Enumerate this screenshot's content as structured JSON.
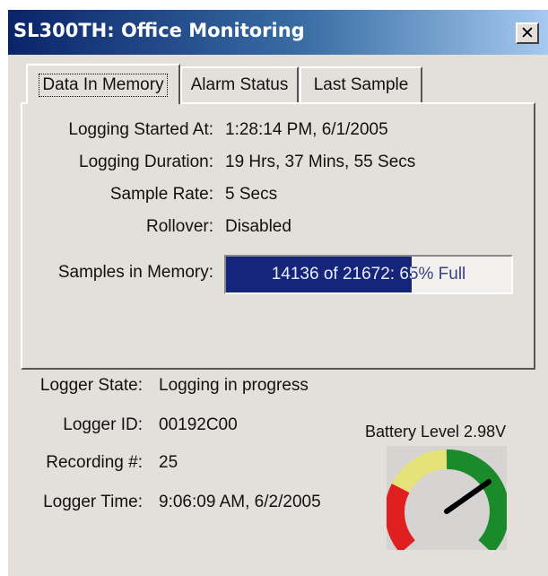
{
  "window": {
    "title": "SL300TH: Office Monitoring",
    "close_glyph": "✕"
  },
  "tabs": [
    {
      "label": "Data In Memory",
      "active": true
    },
    {
      "label": "Alarm Status",
      "active": false
    },
    {
      "label": "Last Sample",
      "active": false
    }
  ],
  "data_in_memory": {
    "logging_started_label": "Logging Started At:",
    "logging_started_value": "1:28:14 PM, 6/1/2005",
    "logging_duration_label": "Logging Duration:",
    "logging_duration_value": "19 Hrs, 37 Mins, 55 Secs",
    "sample_rate_label": "Sample Rate:",
    "sample_rate_value": "5 Secs",
    "rollover_label": "Rollover:",
    "rollover_value": "Disabled",
    "samples_label": "Samples in Memory:",
    "samples_text": "14136 of 21672: 65% Full",
    "samples_fraction": 0.65
  },
  "status": {
    "logger_state_label": "Logger State:",
    "logger_state_value": "Logging in progress",
    "logger_id_label": "Logger ID:",
    "logger_id_value": "00192C00",
    "recording_label": "Recording #:",
    "recording_value": "25",
    "logger_time_label": "Logger Time:",
    "logger_time_value": "9:06:09 AM, 6/2/2005"
  },
  "battery": {
    "label": "Battery Level 2.98V",
    "icon": "battery-gauge-icon",
    "colors": {
      "low": "#e02020",
      "mid": "#e6e27a",
      "high": "#1a8a2a"
    }
  }
}
